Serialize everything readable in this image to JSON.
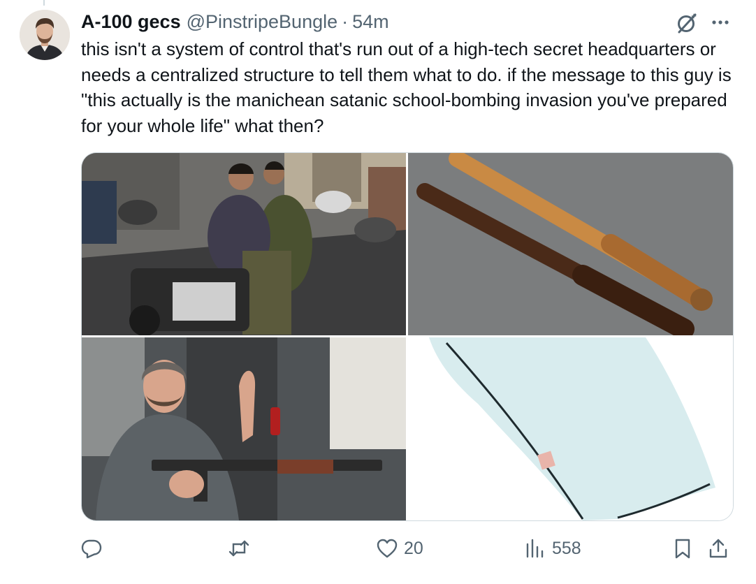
{
  "tweet": {
    "author": {
      "display_name": "A-100 gecs",
      "handle": "@PinstripeBungle",
      "separator": "·",
      "time": "54m",
      "avatar_icon": "avatar-portrait"
    },
    "text": "this isn't a system of control that's run out of a high-tech secret headquarters or needs a centralized structure to tell them what to do. if the message to this guy is \"this actually is the manichean satanic school-bombing invasion you've prepared for your whole life\" what then?",
    "media": [
      {
        "icon": "photo-motorcycle-riders"
      },
      {
        "icon": "photo-wooden-batons"
      },
      {
        "icon": "photo-man-with-rifle"
      },
      {
        "icon": "photo-pillow"
      }
    ],
    "header_icons": [
      "grok-icon",
      "more-icon"
    ],
    "actions": {
      "reply": {
        "icon": "reply-icon",
        "count": ""
      },
      "retweet": {
        "icon": "retweet-icon",
        "count": ""
      },
      "like": {
        "icon": "heart-icon",
        "count": "20"
      },
      "views": {
        "icon": "views-icon",
        "count": "558"
      },
      "bookmark": {
        "icon": "bookmark-icon"
      },
      "share": {
        "icon": "share-icon"
      }
    }
  },
  "colors": {
    "text_primary": "#0f1419",
    "text_secondary": "#536471",
    "border": "#cfd9de",
    "background": "#ffffff"
  }
}
